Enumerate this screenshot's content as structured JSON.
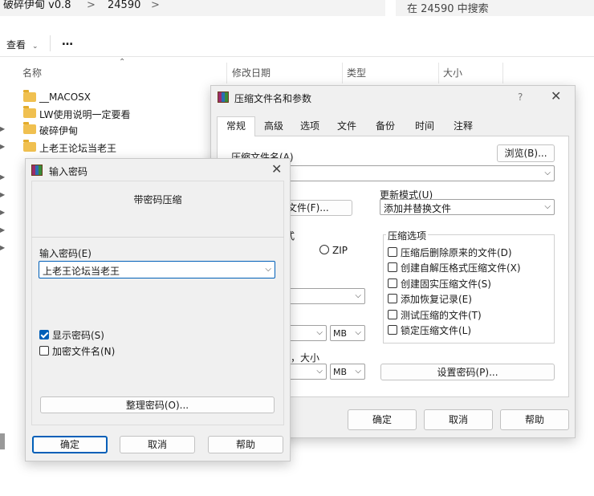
{
  "explorer": {
    "breadcrumb": [
      "破碎伊甸 v0.8",
      "24590"
    ],
    "search_placeholder": "在 24590 中搜索",
    "toolbar": {
      "view_label": "查看",
      "more_label": "…"
    },
    "columns": [
      "名称",
      "修改日期",
      "类型",
      "大小"
    ],
    "files": [
      "__MACOSX",
      "LW使用说明一定要看",
      "破碎伊甸",
      "上老王论坛当老王"
    ]
  },
  "archive_dialog": {
    "title": "压缩文件名和参数",
    "help_icon": "?",
    "tabs": [
      "常规",
      "高级",
      "选项",
      "文件",
      "备份",
      "时间",
      "注释"
    ],
    "archive_name_label": "压缩文件名(A)",
    "browse_label": "浏览(B)...",
    "profiles_label": "文件(F)...",
    "update_mode_label": "更新模式(U)",
    "update_mode_value": "添加并替换文件",
    "format_label": "式",
    "zip_label": "ZIP",
    "options_group_label": "压缩选项",
    "options": [
      {
        "label": "压缩后删除原来的文件(D)",
        "checked": false
      },
      {
        "label": "创建自解压格式压缩文件(X)",
        "checked": false
      },
      {
        "label": "创建固实压缩文件(S)",
        "checked": false
      },
      {
        "label": "添加恢复记录(E)",
        "checked": false
      },
      {
        "label": "测试压缩的文件(T)",
        "checked": false
      },
      {
        "label": "锁定压缩文件(L)",
        "checked": false
      }
    ],
    "unit_mb": "MB",
    "size_label": "，大小",
    "set_password_label": "设置密码(P)...",
    "ok_label": "确定",
    "cancel_label": "取消",
    "help_label": "帮助"
  },
  "password_dialog": {
    "title": "输入密码",
    "heading": "带密码压缩",
    "password_label": "输入密码(E)",
    "password_value": "上老王论坛当老王",
    "show_password_label": "显示密码(S)",
    "show_password_checked": true,
    "encrypt_names_label": "加密文件名(N)",
    "encrypt_names_checked": false,
    "organize_label": "整理密码(O)...",
    "ok_label": "确定",
    "cancel_label": "取消",
    "help_label": "帮助"
  }
}
